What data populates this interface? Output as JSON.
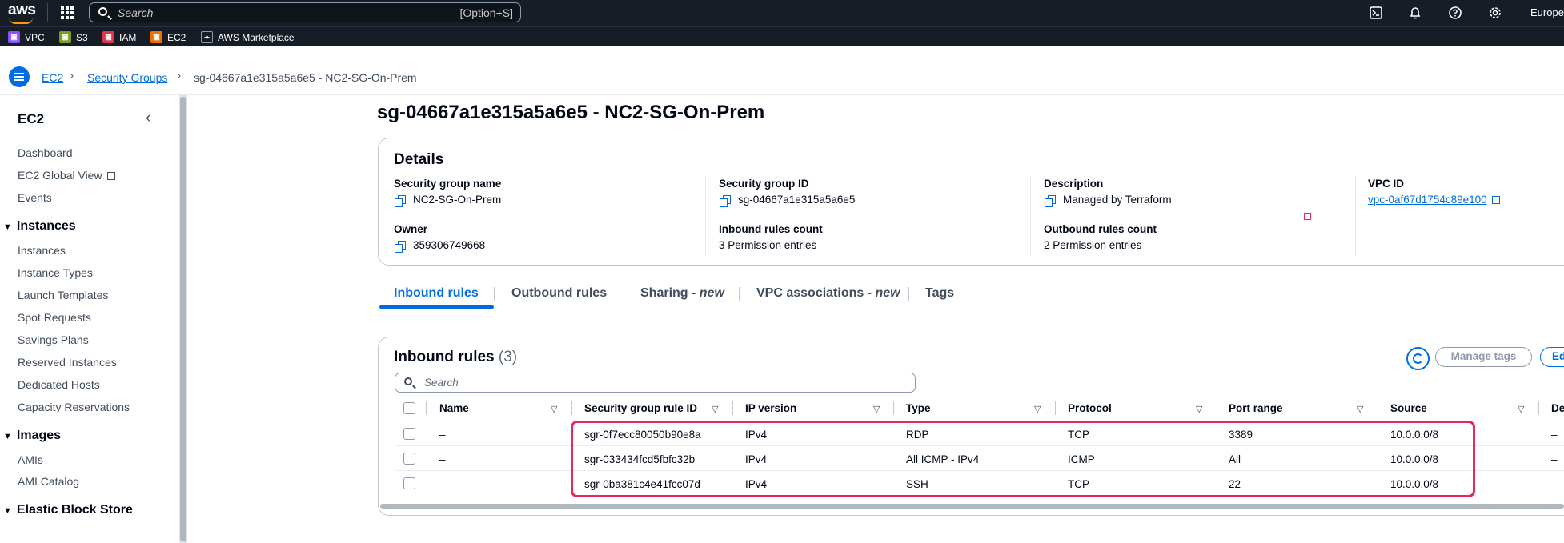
{
  "topnav": {
    "logo": "aws",
    "search_placeholder": "Search",
    "search_shortcut": "[Option+S]",
    "region": "Europe"
  },
  "favorites": [
    {
      "label": "VPC",
      "color": "#8c4fff"
    },
    {
      "label": "S3",
      "color": "#7aa116"
    },
    {
      "label": "IAM",
      "color": "#dd344c"
    },
    {
      "label": "EC2",
      "color": "#ed7100"
    },
    {
      "label": "AWS Marketplace",
      "color": "#161d26"
    }
  ],
  "breadcrumb": {
    "items": [
      "EC2",
      "Security Groups"
    ],
    "current": "sg-04667a1e315a5a6e5 - NC2-SG-On-Prem"
  },
  "sidebar": {
    "title": "EC2",
    "top_links": [
      "Dashboard",
      "EC2 Global View",
      "Events"
    ],
    "sections": [
      {
        "label": "Instances",
        "items": [
          "Instances",
          "Instance Types",
          "Launch Templates",
          "Spot Requests",
          "Savings Plans",
          "Reserved Instances",
          "Dedicated Hosts",
          "Capacity Reservations"
        ]
      },
      {
        "label": "Images",
        "items": [
          "AMIs",
          "AMI Catalog"
        ]
      },
      {
        "label": "Elastic Block Store",
        "items": []
      }
    ]
  },
  "page": {
    "title": "sg-04667a1e315a5a6e5 - NC2-SG-On-Prem"
  },
  "details": {
    "title": "Details",
    "fields": {
      "sg_name_label": "Security group name",
      "sg_name": "NC2-SG-On-Prem",
      "sg_id_label": "Security group ID",
      "sg_id": "sg-04667a1e315a5a6e5",
      "description_label": "Description",
      "description": "Managed by Terraform",
      "vpc_id_label": "VPC ID",
      "vpc_id": "vpc-0af67d1754c89e100",
      "owner_label": "Owner",
      "owner": "359306749668",
      "inbound_count_label": "Inbound rules count",
      "inbound_count": "3 Permission entries",
      "outbound_count_label": "Outbound rules count",
      "outbound_count": "2 Permission entries"
    }
  },
  "tabs": [
    {
      "label": "Inbound rules",
      "suffix": "",
      "active": true
    },
    {
      "label": "Outbound rules",
      "suffix": "",
      "active": false
    },
    {
      "label": "Sharing - ",
      "suffix": "new",
      "active": false
    },
    {
      "label": "VPC associations - ",
      "suffix": "new",
      "active": false
    },
    {
      "label": "Tags",
      "suffix": "",
      "active": false
    }
  ],
  "inbound": {
    "title": "Inbound rules",
    "count": "(3)",
    "manage_tags": "Manage tags",
    "edit_label": "Ed",
    "search_placeholder": "Search",
    "columns": [
      "Name",
      "Security group rule ID",
      "IP version",
      "Type",
      "Protocol",
      "Port range",
      "Source",
      "De"
    ],
    "rows": [
      {
        "name": "–",
        "rule_id": "sgr-0f7ecc80050b90e8a",
        "ip_version": "IPv4",
        "type": "RDP",
        "protocol": "TCP",
        "port_range": "3389",
        "source": "10.0.0.0/8",
        "desc": "–"
      },
      {
        "name": "–",
        "rule_id": "sgr-033434fcd5fbfc32b",
        "ip_version": "IPv4",
        "type": "All ICMP - IPv4",
        "protocol": "ICMP",
        "port_range": "All",
        "source": "10.0.0.0/8",
        "desc": "–"
      },
      {
        "name": "–",
        "rule_id": "sgr-0ba381c4e41fcc07d",
        "ip_version": "IPv4",
        "type": "SSH",
        "protocol": "TCP",
        "port_range": "22",
        "source": "10.0.0.0/8",
        "desc": "–"
      }
    ]
  }
}
